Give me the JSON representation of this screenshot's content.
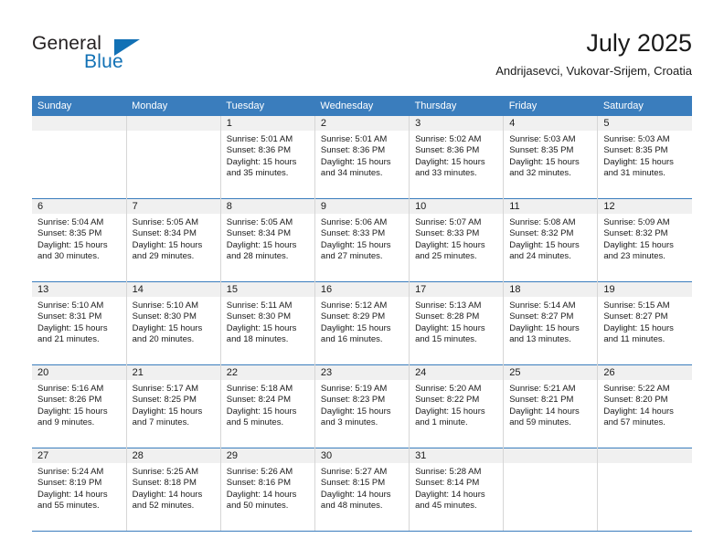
{
  "logo": {
    "word_one": "General",
    "word_two": "Blue",
    "triangle_icon": "triangle-icon",
    "accent_color": "#1271b5"
  },
  "header": {
    "title": "July 2025",
    "subtitle": "Andrijasevci, Vukovar-Srijem, Croatia"
  },
  "theme": {
    "header_blue": "#3a7dbd",
    "daynum_band": "#f0f0f0",
    "cell_border": "#d6d6d6",
    "text": "#1a1a1a"
  },
  "calendar": {
    "weekday_headers": [
      "Sunday",
      "Monday",
      "Tuesday",
      "Wednesday",
      "Thursday",
      "Friday",
      "Saturday"
    ],
    "weeks": [
      [
        {
          "day": "",
          "empty": true,
          "sunrise": "",
          "sunset": "",
          "daylight_line1": "",
          "daylight_line2": ""
        },
        {
          "day": "",
          "empty": true,
          "sunrise": "",
          "sunset": "",
          "daylight_line1": "",
          "daylight_line2": ""
        },
        {
          "day": "1",
          "empty": false,
          "sunrise": "Sunrise: 5:01 AM",
          "sunset": "Sunset: 8:36 PM",
          "daylight_line1": "Daylight: 15 hours",
          "daylight_line2": "and 35 minutes."
        },
        {
          "day": "2",
          "empty": false,
          "sunrise": "Sunrise: 5:01 AM",
          "sunset": "Sunset: 8:36 PM",
          "daylight_line1": "Daylight: 15 hours",
          "daylight_line2": "and 34 minutes."
        },
        {
          "day": "3",
          "empty": false,
          "sunrise": "Sunrise: 5:02 AM",
          "sunset": "Sunset: 8:36 PM",
          "daylight_line1": "Daylight: 15 hours",
          "daylight_line2": "and 33 minutes."
        },
        {
          "day": "4",
          "empty": false,
          "sunrise": "Sunrise: 5:03 AM",
          "sunset": "Sunset: 8:35 PM",
          "daylight_line1": "Daylight: 15 hours",
          "daylight_line2": "and 32 minutes."
        },
        {
          "day": "5",
          "empty": false,
          "sunrise": "Sunrise: 5:03 AM",
          "sunset": "Sunset: 8:35 PM",
          "daylight_line1": "Daylight: 15 hours",
          "daylight_line2": "and 31 minutes."
        }
      ],
      [
        {
          "day": "6",
          "empty": false,
          "sunrise": "Sunrise: 5:04 AM",
          "sunset": "Sunset: 8:35 PM",
          "daylight_line1": "Daylight: 15 hours",
          "daylight_line2": "and 30 minutes."
        },
        {
          "day": "7",
          "empty": false,
          "sunrise": "Sunrise: 5:05 AM",
          "sunset": "Sunset: 8:34 PM",
          "daylight_line1": "Daylight: 15 hours",
          "daylight_line2": "and 29 minutes."
        },
        {
          "day": "8",
          "empty": false,
          "sunrise": "Sunrise: 5:05 AM",
          "sunset": "Sunset: 8:34 PM",
          "daylight_line1": "Daylight: 15 hours",
          "daylight_line2": "and 28 minutes."
        },
        {
          "day": "9",
          "empty": false,
          "sunrise": "Sunrise: 5:06 AM",
          "sunset": "Sunset: 8:33 PM",
          "daylight_line1": "Daylight: 15 hours",
          "daylight_line2": "and 27 minutes."
        },
        {
          "day": "10",
          "empty": false,
          "sunrise": "Sunrise: 5:07 AM",
          "sunset": "Sunset: 8:33 PM",
          "daylight_line1": "Daylight: 15 hours",
          "daylight_line2": "and 25 minutes."
        },
        {
          "day": "11",
          "empty": false,
          "sunrise": "Sunrise: 5:08 AM",
          "sunset": "Sunset: 8:32 PM",
          "daylight_line1": "Daylight: 15 hours",
          "daylight_line2": "and 24 minutes."
        },
        {
          "day": "12",
          "empty": false,
          "sunrise": "Sunrise: 5:09 AM",
          "sunset": "Sunset: 8:32 PM",
          "daylight_line1": "Daylight: 15 hours",
          "daylight_line2": "and 23 minutes."
        }
      ],
      [
        {
          "day": "13",
          "empty": false,
          "sunrise": "Sunrise: 5:10 AM",
          "sunset": "Sunset: 8:31 PM",
          "daylight_line1": "Daylight: 15 hours",
          "daylight_line2": "and 21 minutes."
        },
        {
          "day": "14",
          "empty": false,
          "sunrise": "Sunrise: 5:10 AM",
          "sunset": "Sunset: 8:30 PM",
          "daylight_line1": "Daylight: 15 hours",
          "daylight_line2": "and 20 minutes."
        },
        {
          "day": "15",
          "empty": false,
          "sunrise": "Sunrise: 5:11 AM",
          "sunset": "Sunset: 8:30 PM",
          "daylight_line1": "Daylight: 15 hours",
          "daylight_line2": "and 18 minutes."
        },
        {
          "day": "16",
          "empty": false,
          "sunrise": "Sunrise: 5:12 AM",
          "sunset": "Sunset: 8:29 PM",
          "daylight_line1": "Daylight: 15 hours",
          "daylight_line2": "and 16 minutes."
        },
        {
          "day": "17",
          "empty": false,
          "sunrise": "Sunrise: 5:13 AM",
          "sunset": "Sunset: 8:28 PM",
          "daylight_line1": "Daylight: 15 hours",
          "daylight_line2": "and 15 minutes."
        },
        {
          "day": "18",
          "empty": false,
          "sunrise": "Sunrise: 5:14 AM",
          "sunset": "Sunset: 8:27 PM",
          "daylight_line1": "Daylight: 15 hours",
          "daylight_line2": "and 13 minutes."
        },
        {
          "day": "19",
          "empty": false,
          "sunrise": "Sunrise: 5:15 AM",
          "sunset": "Sunset: 8:27 PM",
          "daylight_line1": "Daylight: 15 hours",
          "daylight_line2": "and 11 minutes."
        }
      ],
      [
        {
          "day": "20",
          "empty": false,
          "sunrise": "Sunrise: 5:16 AM",
          "sunset": "Sunset: 8:26 PM",
          "daylight_line1": "Daylight: 15 hours",
          "daylight_line2": "and 9 minutes."
        },
        {
          "day": "21",
          "empty": false,
          "sunrise": "Sunrise: 5:17 AM",
          "sunset": "Sunset: 8:25 PM",
          "daylight_line1": "Daylight: 15 hours",
          "daylight_line2": "and 7 minutes."
        },
        {
          "day": "22",
          "empty": false,
          "sunrise": "Sunrise: 5:18 AM",
          "sunset": "Sunset: 8:24 PM",
          "daylight_line1": "Daylight: 15 hours",
          "daylight_line2": "and 5 minutes."
        },
        {
          "day": "23",
          "empty": false,
          "sunrise": "Sunrise: 5:19 AM",
          "sunset": "Sunset: 8:23 PM",
          "daylight_line1": "Daylight: 15 hours",
          "daylight_line2": "and 3 minutes."
        },
        {
          "day": "24",
          "empty": false,
          "sunrise": "Sunrise: 5:20 AM",
          "sunset": "Sunset: 8:22 PM",
          "daylight_line1": "Daylight: 15 hours",
          "daylight_line2": "and 1 minute."
        },
        {
          "day": "25",
          "empty": false,
          "sunrise": "Sunrise: 5:21 AM",
          "sunset": "Sunset: 8:21 PM",
          "daylight_line1": "Daylight: 14 hours",
          "daylight_line2": "and 59 minutes."
        },
        {
          "day": "26",
          "empty": false,
          "sunrise": "Sunrise: 5:22 AM",
          "sunset": "Sunset: 8:20 PM",
          "daylight_line1": "Daylight: 14 hours",
          "daylight_line2": "and 57 minutes."
        }
      ],
      [
        {
          "day": "27",
          "empty": false,
          "sunrise": "Sunrise: 5:24 AM",
          "sunset": "Sunset: 8:19 PM",
          "daylight_line1": "Daylight: 14 hours",
          "daylight_line2": "and 55 minutes."
        },
        {
          "day": "28",
          "empty": false,
          "sunrise": "Sunrise: 5:25 AM",
          "sunset": "Sunset: 8:18 PM",
          "daylight_line1": "Daylight: 14 hours",
          "daylight_line2": "and 52 minutes."
        },
        {
          "day": "29",
          "empty": false,
          "sunrise": "Sunrise: 5:26 AM",
          "sunset": "Sunset: 8:16 PM",
          "daylight_line1": "Daylight: 14 hours",
          "daylight_line2": "and 50 minutes."
        },
        {
          "day": "30",
          "empty": false,
          "sunrise": "Sunrise: 5:27 AM",
          "sunset": "Sunset: 8:15 PM",
          "daylight_line1": "Daylight: 14 hours",
          "daylight_line2": "and 48 minutes."
        },
        {
          "day": "31",
          "empty": false,
          "sunrise": "Sunrise: 5:28 AM",
          "sunset": "Sunset: 8:14 PM",
          "daylight_line1": "Daylight: 14 hours",
          "daylight_line2": "and 45 minutes."
        },
        {
          "day": "",
          "empty": true,
          "sunrise": "",
          "sunset": "",
          "daylight_line1": "",
          "daylight_line2": ""
        },
        {
          "day": "",
          "empty": true,
          "sunrise": "",
          "sunset": "",
          "daylight_line1": "",
          "daylight_line2": ""
        }
      ]
    ]
  }
}
